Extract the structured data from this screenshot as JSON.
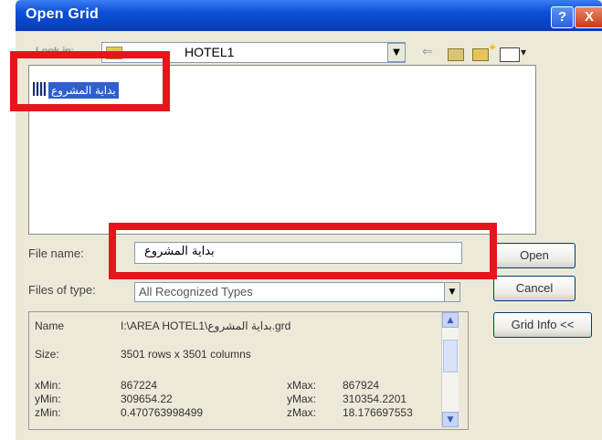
{
  "window": {
    "title": "Open Grid",
    "help_glyph": "?",
    "close_glyph": "X"
  },
  "lookin": {
    "label": "Look in:",
    "value": "HOTEL1",
    "dropdown_glyph": "▼"
  },
  "toolbar": {
    "back_glyph": "⇐",
    "views_arrow": "▾"
  },
  "file_list": {
    "items": [
      {
        "name": "بداية المشروع",
        "icon": "grid-file-icon",
        "selected": true
      }
    ]
  },
  "filename": {
    "label": "File name:",
    "value": "بداية المشروع"
  },
  "filetype": {
    "label": "Files of type:",
    "value": "All Recognized Types",
    "dropdown_glyph": "▼"
  },
  "buttons": {
    "open": "Open",
    "cancel": "Cancel",
    "grid_info": "Grid Info <<"
  },
  "info": {
    "name_label": "Name",
    "name_value": "I:\\AREA  HOTEL1\\بداية المشروع.grd",
    "size_label": "Size:",
    "size_value": "3501 rows x 3501 columns",
    "xmin_label": "xMin:",
    "xmin_value": "867224",
    "ymin_label": "yMin:",
    "ymin_value": "309654.22",
    "zmin_label": "zMin:",
    "zmin_value": "0.470763998499",
    "xmax_label": "xMax:",
    "xmax_value": "867924",
    "ymax_label": "yMax:",
    "ymax_value": "310354.2201",
    "zmax_label": "zMax:",
    "zmax_value": "18.176697553",
    "scroll_up": "▲",
    "scroll_down": "▼"
  },
  "colors": {
    "highlight": "#e8141c",
    "titlebar": "#0a4fd6",
    "selection": "#2f5fcf"
  }
}
